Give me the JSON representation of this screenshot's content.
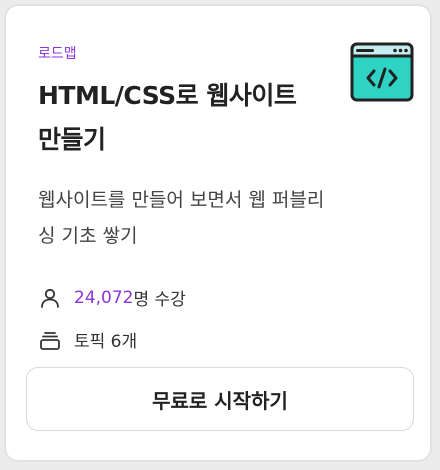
{
  "card": {
    "badge": "로드맵",
    "title": "HTML/CSS로 웹사이트 만들기",
    "description": "웹사이트를 만들어 보면서 웹 퍼블리싱 기초 쌓기",
    "title_icon": "code-window-icon",
    "students": {
      "icon": "person-icon",
      "count": "24,072",
      "suffix": "명 수강"
    },
    "topics": {
      "icon": "stack-icon",
      "text": "토픽 6개"
    },
    "cta_label": "무료로 시작하기"
  },
  "colors": {
    "accent": "#8b35e0",
    "icon_teal": "#2ed3c4",
    "icon_window_bar": "#c6eef0",
    "border": "#e2e2e2"
  }
}
